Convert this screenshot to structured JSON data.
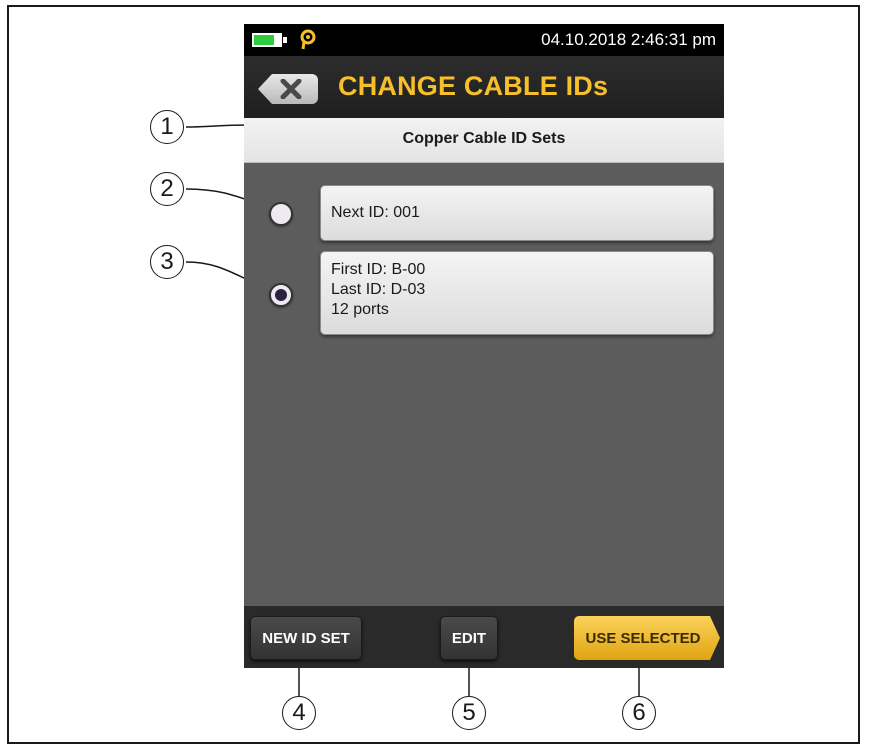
{
  "status_bar": {
    "datetime": "04.10.2018 2:46:31 pm",
    "battery_icon": "battery-icon",
    "probe_icon": "probe-icon",
    "battery_color": "#2ecc40"
  },
  "header": {
    "title": "CHANGE CABLE IDs",
    "close_icon": "close-icon",
    "title_color": "#f7bf2a"
  },
  "section": {
    "title": "Copper Cable ID Sets"
  },
  "id_sets": [
    {
      "lines": [
        "Next ID: 001"
      ],
      "selected": false
    },
    {
      "lines": [
        "First ID: B-00",
        "Last ID: D-03",
        "12 ports"
      ],
      "selected": true
    }
  ],
  "buttons": {
    "new_id_set": "NEW ID SET",
    "edit": "EDIT",
    "use_selected": "USE SELECTED",
    "accent_color": "#f5b82a"
  },
  "callouts": [
    "1",
    "2",
    "3",
    "4",
    "5",
    "6"
  ]
}
